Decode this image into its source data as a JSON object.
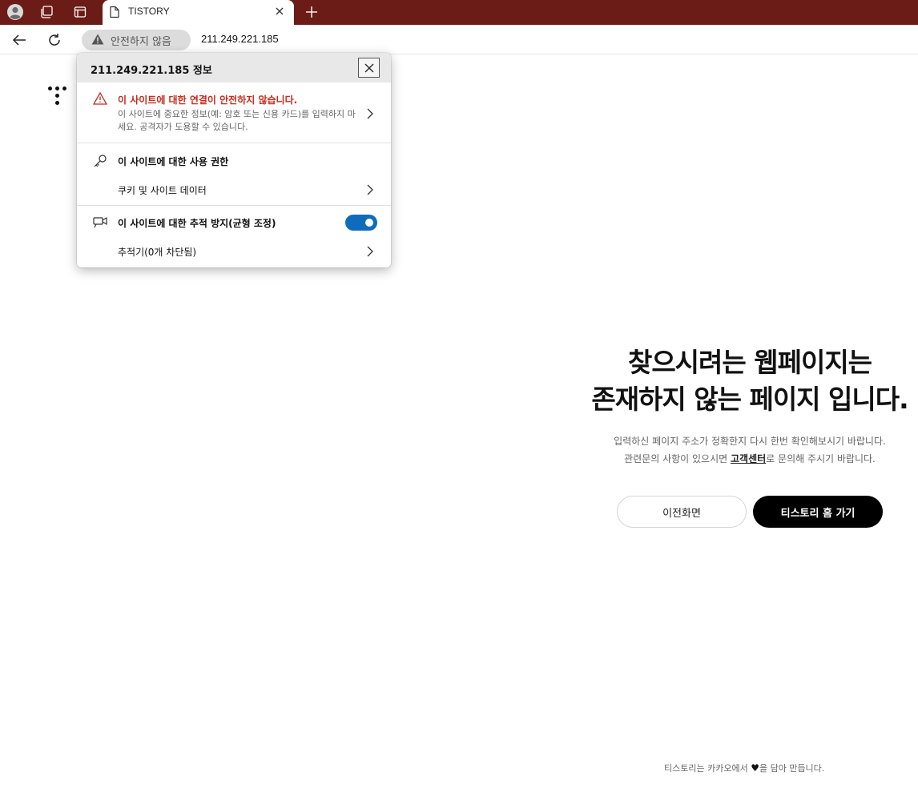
{
  "browser": {
    "tab_title": "TISTORY",
    "security_label": "안전하지 않음",
    "url": "211.249.221.185",
    "accent_color": "#6b1c17"
  },
  "page": {
    "title_line1": "찾으시려는 웹페이지는",
    "title_line2": "존재하지 않는 페이지 입니다.",
    "desc_line1": "입력하신 페이지 주소가 정확한지 다시 한번 확인해보시기 바랍니다.",
    "desc_line2_pre": "관련문의 사항이 있으시면 ",
    "desc_link": "고객센터",
    "desc_line2_post": "로 문의해 주시기 바랍니다.",
    "prev_button": "이전화면",
    "home_button": "티스토리 홈 가기",
    "footer_pre": "티스토리는 카카오에서 ",
    "footer_heart": "♥",
    "footer_post": "을 담아 만듭니다."
  },
  "popup": {
    "title": "211.249.221.185 정보",
    "warning_title": "이 사이트에 대한 연결이 안전하지 않습니다.",
    "warning_body": "이 사이트에 중요한 정보(예: 암호 또는 신용 카드)를 입력하지 마세요. 공격자가 도용할 수 있습니다.",
    "permissions_label": "이 사이트에 대한 사용 권한",
    "cookies_label": "쿠키 및 사이트 데이터",
    "tracking_label": "이 사이트에 대한 추적 방지(균형 조정)",
    "tracking_enabled": true,
    "trackers_label": "추적기(0개 차단됨)",
    "warning_color": "#c42b1c",
    "toggle_color": "#0f6cbd"
  }
}
